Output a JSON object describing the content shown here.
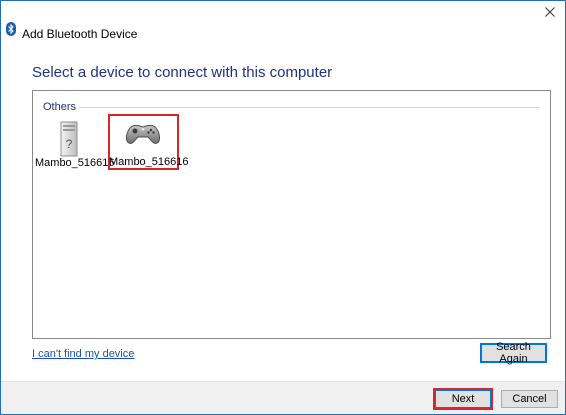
{
  "window": {
    "title": "Add Bluetooth Device",
    "title_icon": "bluetooth-icon",
    "close_icon": "close-icon"
  },
  "main": {
    "heading": "Select a device to connect with this computer",
    "group_label": "Others",
    "devices": [
      {
        "label": "Mambo_516616",
        "icon": "unknown-device-icon",
        "selected": false
      },
      {
        "label": "Mambo_516616",
        "icon": "gamepad-icon",
        "selected": true
      }
    ],
    "link_text": "I can't find my device",
    "search_again_label": "Search Again"
  },
  "footer": {
    "next_label": "Next",
    "cancel_label": "Cancel"
  },
  "colors": {
    "heading": "#1e3287",
    "highlight": "#d9262b",
    "link": "#1a50b8",
    "focus": "#0078d7"
  }
}
